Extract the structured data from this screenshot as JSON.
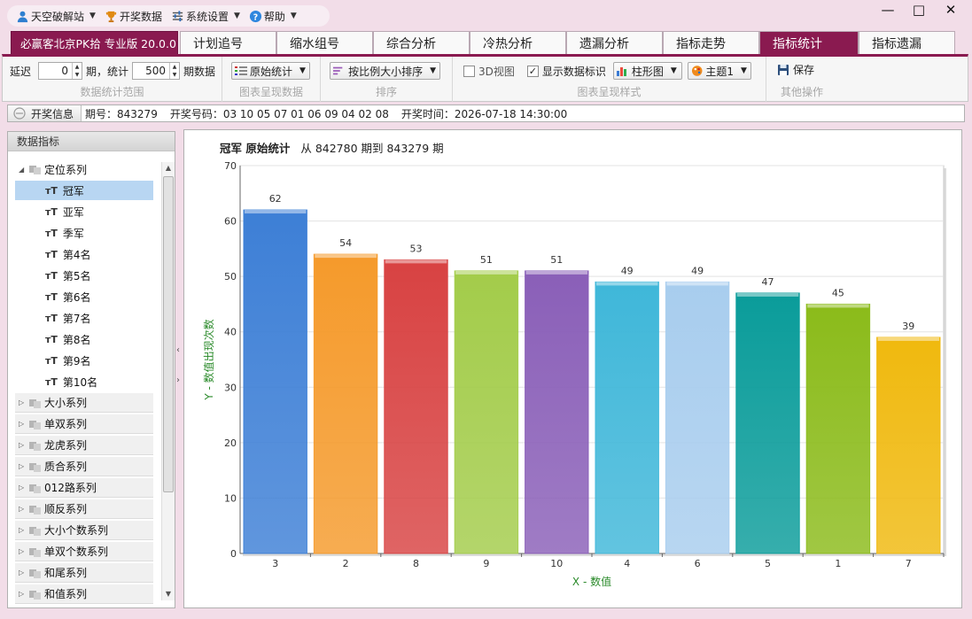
{
  "menubar": {
    "items": [
      {
        "label": "天空破解站",
        "icon": "user-icon",
        "has_dropdown": true
      },
      {
        "label": "开奖数据",
        "icon": "trophy-icon",
        "has_dropdown": false
      },
      {
        "label": "系统设置",
        "icon": "sliders-icon",
        "has_dropdown": true
      },
      {
        "label": "帮助",
        "icon": "help-icon",
        "has_dropdown": true
      }
    ]
  },
  "window_controls": {
    "minimize": "—",
    "maximize": "□",
    "close": "✕"
  },
  "tabs": {
    "brand": "必赢客北京PK拾 专业版 20.0.0",
    "items": [
      "计划追号",
      "缩水组号",
      "综合分析",
      "冷热分析",
      "遗漏分析",
      "指标走势",
      "指标统计",
      "指标遗漏"
    ],
    "active_index": 6
  },
  "toolbar": {
    "range": {
      "delay_label": "延迟",
      "delay_value": "0",
      "period_label": "期，统计",
      "count_value": "500",
      "count_suffix": "期数据",
      "group_label": "数据统计范围"
    },
    "present": {
      "dropdown": "原始统计",
      "group_label": "图表呈现数据"
    },
    "sort": {
      "dropdown": "按比例大小排序",
      "group_label": "排序"
    },
    "style": {
      "view3d_label": "3D视图",
      "view3d_checked": false,
      "show_labels_label": "显示数据标识",
      "show_labels_checked": true,
      "chart_type": "柱形图",
      "theme": "主题1",
      "group_label": "图表呈现样式"
    },
    "other": {
      "save_label": "保存",
      "group_label": "其他操作"
    }
  },
  "infobar": {
    "label": "开奖信息",
    "period": "期号：843279",
    "numbers": "开奖号码：03 10 05 07 01 06 09 04 02 08",
    "time": "开奖时间：2026-07-18 14:30:00"
  },
  "sidebar": {
    "header": "数据指标",
    "expanded_group": "定位系列",
    "sub_items": [
      "冠军",
      "亚军",
      "季军",
      "第4名",
      "第5名",
      "第6名",
      "第7名",
      "第8名",
      "第9名",
      "第10名"
    ],
    "selected_sub": 0,
    "groups": [
      "大小系列",
      "单双系列",
      "龙虎系列",
      "质合系列",
      "012路系列",
      "顺反系列",
      "大小个数系列",
      "单双个数系列",
      "和尾系列",
      "和值系列"
    ]
  },
  "chart_header": {
    "title": "冠军 原始统计",
    "subtitle": "从 842780 期到 843279 期"
  },
  "chart_data": {
    "type": "bar",
    "categories": [
      "3",
      "2",
      "8",
      "9",
      "10",
      "4",
      "6",
      "5",
      "1",
      "7"
    ],
    "values": [
      62,
      54,
      53,
      51,
      51,
      49,
      49,
      47,
      45,
      39
    ],
    "colors": [
      "#3d7fd6",
      "#f59a2b",
      "#d84242",
      "#a3cc4a",
      "#8a5fb8",
      "#3fb7d9",
      "#a8cdee",
      "#0a9c9a",
      "#8bbb1a",
      "#f0b90e"
    ],
    "xlabel": "X - 数值",
    "ylabel": "Y - 数值出现次数",
    "ylim": [
      0,
      70
    ],
    "yticks": [
      0,
      10,
      20,
      30,
      40,
      50,
      60,
      70
    ],
    "data_labels": true,
    "grid": true,
    "axis_label_color": "#2a8a2a"
  }
}
